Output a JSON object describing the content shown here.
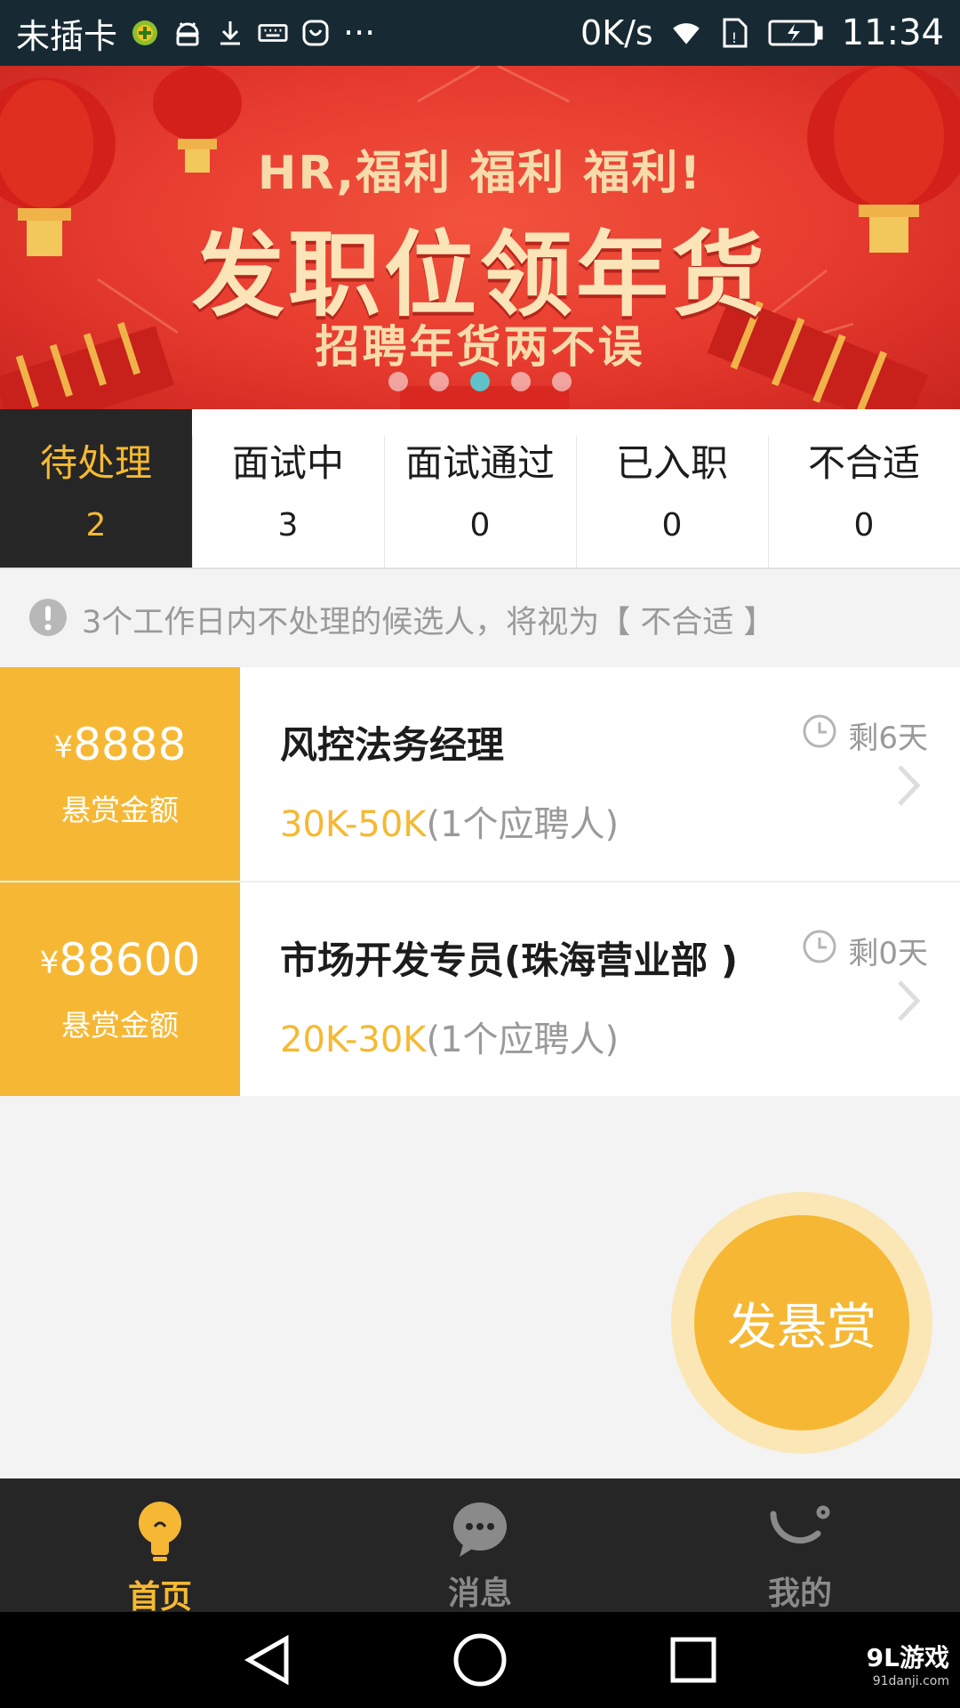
{
  "status_bar": {
    "carrier": "未插卡",
    "more": "···",
    "speed": "0K/s",
    "time": "11:34",
    "icons": [
      "plus-badge-icon",
      "android-icon",
      "download-icon",
      "keyboard-icon",
      "huawei-icon",
      "wifi-icon",
      "sim-icon",
      "battery-icon"
    ]
  },
  "banner": {
    "subtitle": "HR,福利 福利 福利!",
    "title": "发职位领年货",
    "tagline": "招聘年货两不误",
    "dot_count": 5,
    "active_dot": 2
  },
  "tabs": [
    {
      "label": "待处理",
      "count": "2",
      "active": true
    },
    {
      "label": "面试中",
      "count": "3",
      "active": false
    },
    {
      "label": "面试通过",
      "count": "0",
      "active": false
    },
    {
      "label": "已入职",
      "count": "0",
      "active": false
    },
    {
      "label": "不合适",
      "count": "0",
      "active": false
    }
  ],
  "notice": {
    "text": "3个工作日内不处理的候选人，将视为【 不合适 】"
  },
  "jobs": [
    {
      "reward_currency": "¥",
      "reward_amount": "8888",
      "reward_label": "悬赏金额",
      "title": "风控法务经理",
      "salary": "30K-50K",
      "applicants": "(1个应聘人)",
      "remaining": "剩6天"
    },
    {
      "reward_currency": "¥",
      "reward_amount": "88600",
      "reward_label": "悬赏金额",
      "title": "市场开发专员(珠海营业部 )",
      "salary": "20K-30K",
      "applicants": "(1个应聘人)",
      "remaining": "剩0天"
    }
  ],
  "fab": {
    "label": "发悬赏"
  },
  "bottom_nav": [
    {
      "label": "首页",
      "icon": "lightbulb-icon",
      "active": true
    },
    {
      "label": "消息",
      "icon": "chat-bubble-icon",
      "active": false
    },
    {
      "label": "我的",
      "icon": "smile-arc-icon",
      "active": false
    }
  ],
  "system_nav": {
    "icons": [
      "back-triangle-icon",
      "home-circle-icon",
      "recents-square-icon"
    ]
  },
  "watermark": {
    "brand": "9L游戏",
    "url": "91danji.com"
  },
  "colors": {
    "accent": "#f6b834",
    "status_bar": "#172a33",
    "banner_red": "#e63a2e",
    "nav_dark": "#262626",
    "active_dot": "#5fc2c9"
  }
}
